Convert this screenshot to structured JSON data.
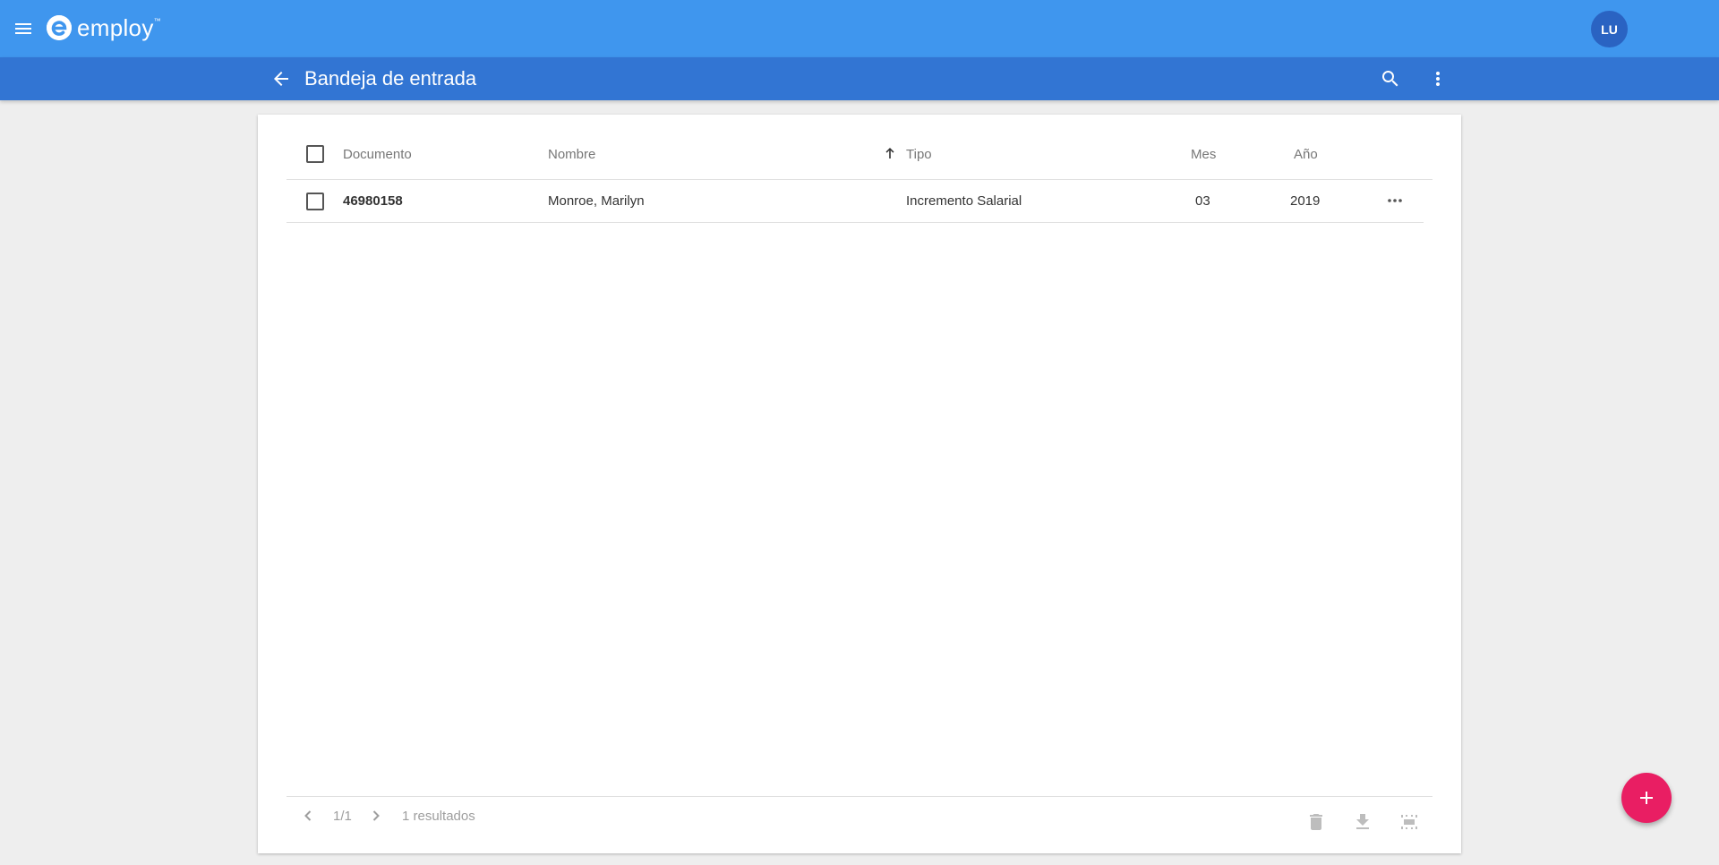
{
  "app": {
    "logo_text": "employ",
    "logo_tm": "™",
    "user_initials": "LU"
  },
  "page": {
    "title": "Bandeja de entrada"
  },
  "table": {
    "columns": [
      "Documento",
      "Nombre",
      "Tipo",
      "Mes",
      "Año"
    ],
    "sorted_column": "Tipo",
    "sort_direction": "ascending",
    "rows": [
      {
        "documento": "46980158",
        "nombre": "Monroe, Marilyn",
        "tipo": "Incremento Salarial",
        "mes": "03",
        "anio": "2019"
      }
    ]
  },
  "pagination": {
    "page": "1/1",
    "results": "1 resultados"
  },
  "icons": {
    "menu": "menu-icon",
    "back": "arrow-back-icon",
    "search": "search-icon",
    "more": "more-vert-icon",
    "row_more": "more-horiz-icon",
    "prev": "chevron-left-icon",
    "next": "chevron-right-icon",
    "delete": "trash-icon",
    "download": "download-icon",
    "select_area": "select-area-icon",
    "add": "plus-icon"
  },
  "colors": {
    "topbar": "#3f96ee",
    "subbar": "#3275d3",
    "fab": "#e91e63",
    "avatar": "#2a63c2"
  }
}
